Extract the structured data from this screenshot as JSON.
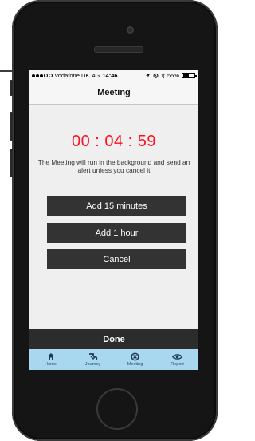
{
  "status_bar": {
    "signal_dots": 5,
    "signal_filled": 3,
    "carrier": "vodafone UK",
    "network": "4G",
    "time": "14:46",
    "battery_percent": "55%",
    "battery_level": 0.55
  },
  "nav": {
    "title": "Meeting"
  },
  "timer": {
    "value": "00 : 04 : 59",
    "color": "#ff0f1f"
  },
  "description": "The Meeting will run in the background and send an alert unless you cancel it",
  "buttons": {
    "add_15": "Add 15 minutes",
    "add_1h": "Add 1 hour",
    "cancel": "Cancel"
  },
  "done": "Done",
  "tabs": [
    {
      "label": "Home",
      "icon": "home-icon"
    },
    {
      "label": "Journey",
      "icon": "journey-icon"
    },
    {
      "label": "Meeting",
      "icon": "meeting-icon"
    },
    {
      "label": "Report",
      "icon": "report-eye-icon"
    }
  ],
  "colors": {
    "accent_bar": "#a8d8ef",
    "button": "#333333"
  }
}
